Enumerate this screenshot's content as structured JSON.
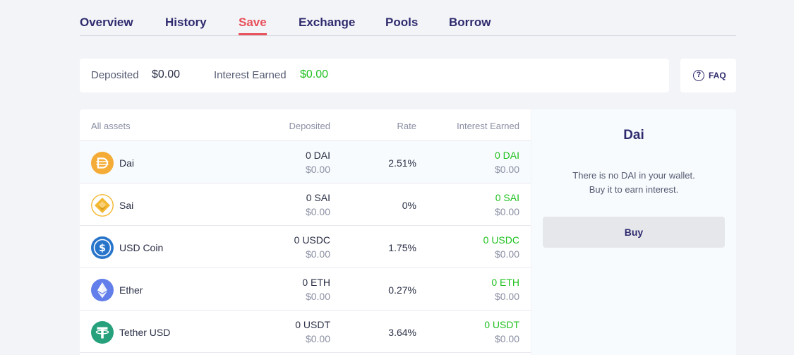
{
  "tabs": [
    {
      "label": "Overview",
      "active": false
    },
    {
      "label": "History",
      "active": false
    },
    {
      "label": "Save",
      "active": true
    },
    {
      "label": "Exchange",
      "active": false
    },
    {
      "label": "Pools",
      "active": false
    },
    {
      "label": "Borrow",
      "active": false
    }
  ],
  "summary": {
    "deposited_label": "Deposited",
    "deposited_value": "$0.00",
    "interest_label": "Interest Earned",
    "interest_value": "$0.00"
  },
  "faq": {
    "label": "FAQ",
    "icon": "question-circle-icon"
  },
  "table": {
    "headers": {
      "asset": "All assets",
      "deposited": "Deposited",
      "rate": "Rate",
      "interest": "Interest Earned"
    },
    "rows": [
      {
        "name": "Dai",
        "icon": "dai-icon",
        "deposited": "0 DAI",
        "deposited_usd": "$0.00",
        "rate": "2.51%",
        "interest": "0 DAI",
        "interest_usd": "$0.00"
      },
      {
        "name": "Sai",
        "icon": "sai-icon",
        "deposited": "0 SAI",
        "deposited_usd": "$0.00",
        "rate": "0%",
        "interest": "0 SAI",
        "interest_usd": "$0.00"
      },
      {
        "name": "USD Coin",
        "icon": "usdc-icon",
        "deposited": "0 USDC",
        "deposited_usd": "$0.00",
        "rate": "1.75%",
        "interest": "0 USDC",
        "interest_usd": "$0.00"
      },
      {
        "name": "Ether",
        "icon": "ether-icon",
        "deposited": "0 ETH",
        "deposited_usd": "$0.00",
        "rate": "0.27%",
        "interest": "0 ETH",
        "interest_usd": "$0.00"
      },
      {
        "name": "Tether USD",
        "icon": "tether-icon",
        "deposited": "0 USDT",
        "deposited_usd": "$0.00",
        "rate": "3.64%",
        "interest": "0 USDT",
        "interest_usd": "$0.00"
      }
    ]
  },
  "panel": {
    "title": "Dai",
    "message_line1": "There is no DAI in your wallet.",
    "message_line2": "Buy it to earn interest.",
    "buy_label": "Buy"
  },
  "colors": {
    "accent": "#e8505b",
    "brand": "#2f2b6e",
    "positive": "#1fc11f",
    "dai": "#f5ac37",
    "sai": "#f4b731",
    "usdc": "#2775ca",
    "ether": "#627eea",
    "tether": "#26a17b"
  }
}
